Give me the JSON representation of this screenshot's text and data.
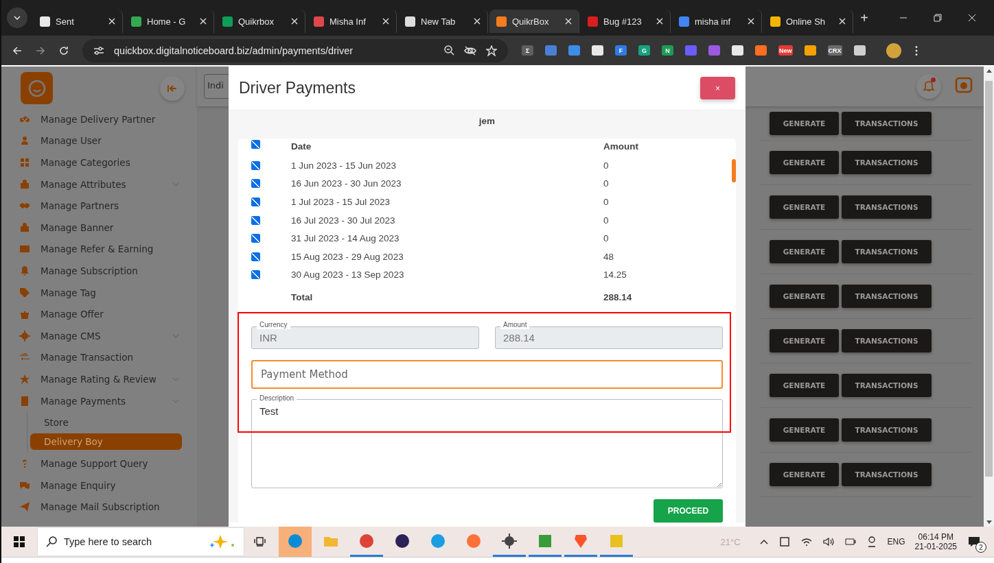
{
  "browser": {
    "tabs": [
      {
        "title": "Sent",
        "selected": false,
        "color": "#e8e8e8"
      },
      {
        "title": "Home - G",
        "selected": false,
        "color": "#34a853"
      },
      {
        "title": "Quikrbox",
        "selected": false,
        "color": "#0f9d58"
      },
      {
        "title": "Misha Inf",
        "selected": false,
        "color": "#e0474c"
      },
      {
        "title": "New Tab",
        "selected": false,
        "color": "#dddddd"
      },
      {
        "title": "QuikrBox",
        "selected": true,
        "color": "#f57c1f"
      },
      {
        "title": "Bug #123",
        "selected": false,
        "color": "#d81e1e"
      },
      {
        "title": "misha inf",
        "selected": false,
        "color": "#4285f4"
      },
      {
        "title": "Online Sh",
        "selected": false,
        "color": "#f4b400"
      }
    ],
    "new_tab": "+",
    "address": "quickbox.digitalnoticeboard.biz/admin/payments/driver",
    "extensions": [
      {
        "label": "Σ",
        "color": "#5f5f5f"
      },
      {
        "color": "#4a7fd6"
      },
      {
        "color": "#3b8ee8"
      },
      {
        "color": "#e8e8e8"
      },
      {
        "label": "F",
        "color": "#2f7be0"
      },
      {
        "label": "G",
        "color": "#15a37f"
      },
      {
        "label": "N",
        "color": "#1d9b57"
      },
      {
        "color": "#6a5cff"
      },
      {
        "color": "#9b59e0"
      },
      {
        "color": "#e8e8e8"
      },
      {
        "color": "#ff6d1f"
      },
      {
        "label": "New",
        "color": "#e53935"
      },
      {
        "color": "#f4a100"
      },
      {
        "label": "CRX",
        "color": "#6b6b6b"
      },
      {
        "color": "#cfcfcf"
      }
    ]
  },
  "sidebar": {
    "items": [
      {
        "label": "Manage Delivery Partner",
        "expandable": false
      },
      {
        "label": "Manage User",
        "expandable": false
      },
      {
        "label": "Manage Categories",
        "expandable": false
      },
      {
        "label": "Manage Attributes",
        "expandable": true
      },
      {
        "label": "Manage Partners",
        "expandable": false
      },
      {
        "label": "Manage Banner",
        "expandable": false
      },
      {
        "label": "Manage Refer & Earning",
        "expandable": false
      },
      {
        "label": "Manage Subscription",
        "expandable": false
      },
      {
        "label": "Manage Tag",
        "expandable": false
      },
      {
        "label": "Manage Offer",
        "expandable": false
      },
      {
        "label": "Manage CMS",
        "expandable": true
      },
      {
        "label": "Manage Transaction",
        "expandable": false
      },
      {
        "label": "Manage Rating & Review",
        "expandable": true
      },
      {
        "label": "Manage Payments",
        "expandable": true,
        "children": [
          {
            "label": "Store",
            "selected": false
          },
          {
            "label": "Delivery Boy",
            "selected": true
          }
        ]
      },
      {
        "label": "Manage Support Query",
        "expandable": false
      },
      {
        "label": "Manage Enquiry",
        "expandable": false
      },
      {
        "label": "Manage Mail Subscription",
        "expandable": false
      }
    ]
  },
  "header": {
    "search_value": "Indi",
    "notification_dot": true
  },
  "rows": [
    {
      "actions": [
        "GENERATE",
        "TRANSACTIONS"
      ]
    },
    {
      "actions": [
        "GENERATE",
        "TRANSACTIONS"
      ]
    },
    {
      "actions": [
        "GENERATE",
        "TRANSACTIONS"
      ]
    },
    {
      "actions": [
        "GENERATE",
        "TRANSACTIONS"
      ]
    },
    {
      "actions": [
        "GENERATE",
        "TRANSACTIONS"
      ]
    },
    {
      "actions": [
        "GENERATE",
        "TRANSACTIONS"
      ]
    },
    {
      "actions": [
        "GENERATE",
        "TRANSACTIONS"
      ]
    },
    {
      "actions": [
        "GENERATE",
        "TRANSACTIONS"
      ]
    },
    {
      "actions": [
        "GENERATE",
        "TRANSACTIONS"
      ]
    }
  ],
  "modal": {
    "title": "Driver Payments",
    "close": "×",
    "driver": "jem",
    "table": {
      "all_checked": true,
      "columns": [
        "Date",
        "Amount"
      ],
      "rows": [
        {
          "date": "1 Jun 2023 - 15 Jun 2023",
          "amount": "0",
          "checked": true
        },
        {
          "date": "16 Jun 2023 - 30 Jun 2023",
          "amount": "0",
          "checked": true
        },
        {
          "date": "1 Jul 2023 - 15 Jul 2023",
          "amount": "0",
          "checked": true
        },
        {
          "date": "16 Jul 2023 - 30 Jul 2023",
          "amount": "0",
          "checked": true
        },
        {
          "date": "31 Jul 2023 - 14 Aug 2023",
          "amount": "0",
          "checked": true
        },
        {
          "date": "15 Aug 2023 - 29 Aug 2023",
          "amount": "48",
          "checked": true
        },
        {
          "date": "30 Aug 2023 - 13 Sep 2023",
          "amount": "14.25",
          "checked": true
        }
      ],
      "total_label": "Total",
      "total": "288.14"
    },
    "currency": {
      "label": "Currency",
      "value": "INR",
      "disabled": true
    },
    "amount": {
      "label": "Amount",
      "value": "288.14",
      "disabled": true
    },
    "payment_method": {
      "placeholder": "Payment Method",
      "focused": true
    },
    "description": {
      "label": "Description",
      "value": "Test"
    },
    "submit": "PROCEED"
  },
  "taskbar": {
    "search_placeholder": "Type here to search",
    "apps": [
      {
        "kind": "skype",
        "color": "#0a8bd6",
        "running": false,
        "flashing": true
      },
      {
        "kind": "folder",
        "color": "#f2b632",
        "running": false,
        "flashing": false
      },
      {
        "kind": "chrome",
        "color": "#db4437",
        "running": true,
        "flashing": false
      },
      {
        "kind": "eclipse",
        "color": "#2c2255",
        "running": false,
        "flashing": false
      },
      {
        "kind": "edge",
        "color": "#1b9de2",
        "running": false,
        "flashing": false
      },
      {
        "kind": "firefox",
        "color": "#ff7139",
        "running": false,
        "flashing": false
      },
      {
        "kind": "gear",
        "color": "#444444",
        "running": true,
        "flashing": false
      },
      {
        "kind": "notepad",
        "color": "#3a9b3a",
        "running": true,
        "flashing": false
      },
      {
        "kind": "brave",
        "color": "#fb542b",
        "running": true,
        "flashing": false
      },
      {
        "kind": "window",
        "color": "#e8c120",
        "running": true,
        "flashing": false
      }
    ],
    "weather": "21°C",
    "language": "ENG",
    "time": "06:14 PM",
    "date": "21-01-2025",
    "notifications": "2"
  }
}
